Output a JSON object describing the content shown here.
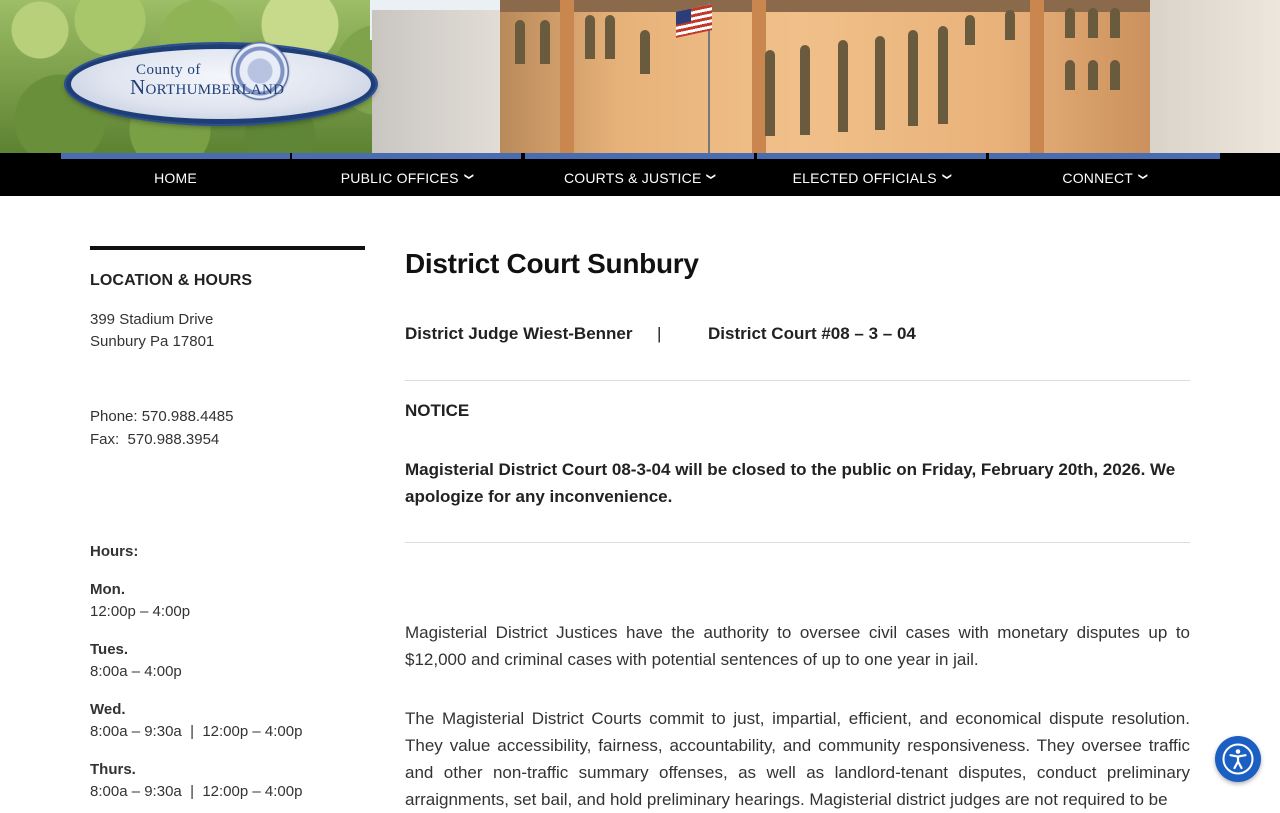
{
  "header": {
    "logo_top": "County of",
    "logo_main": "Northumberland"
  },
  "nav": {
    "items": [
      {
        "label": "HOME",
        "has_dropdown": false
      },
      {
        "label": "PUBLIC OFFICES",
        "has_dropdown": true
      },
      {
        "label": "COURTS & JUSTICE",
        "has_dropdown": true
      },
      {
        "label": "ELECTED OFFICIALS",
        "has_dropdown": true
      },
      {
        "label": "CONNECT",
        "has_dropdown": true
      }
    ],
    "accent_color": "#4a6cb0"
  },
  "sidebar": {
    "title": "LOCATION & HOURS",
    "address_line1": "399 Stadium Drive",
    "address_line2": "Sunbury Pa 17801",
    "phone": "Phone: 570.988.4485",
    "fax": "Fax:  570.988.3954",
    "hours_label": "Hours:",
    "hours": [
      {
        "day": "Mon.",
        "time": "12:00p – 4:00p"
      },
      {
        "day": "Tues.",
        "time": "8:00a – 4:00p"
      },
      {
        "day": "Wed.",
        "time": "8:00a – 9:30a  |  12:00p – 4:00p"
      },
      {
        "day": "Thurs.",
        "time": "8:00a – 9:30a  |  12:00p – 4:00p"
      }
    ]
  },
  "main": {
    "title": "District Court Sunbury",
    "judge": "District Judge Wiest-Benner",
    "separator": "|",
    "court_number": "District Court #08 – 3 – 04",
    "notice_label": "NOTICE",
    "notice_text": "Magisterial District Court 08-3-04 will be closed to the public on Friday, February 20th, 2026. We apologize for any inconvenience.",
    "paragraph1": "Magisterial District Justices have the authority to oversee civil cases with monetary disputes up to $12,000 and criminal cases with potential sentences of up to one year in jail.",
    "paragraph2": "The Magisterial District Courts commit to just, impartial, efficient, and economical dispute resolution. They value accessibility, fairness, accountability, and community responsiveness. They oversee traffic and other non-traffic summary offenses, as well as landlord-tenant disputes, conduct preliminary arraignments, set bail, and hold preliminary hearings. Magisterial district judges are not required to be"
  },
  "accessibility": {
    "icon": "accessibility-icon",
    "color": "#1a5fc1"
  }
}
